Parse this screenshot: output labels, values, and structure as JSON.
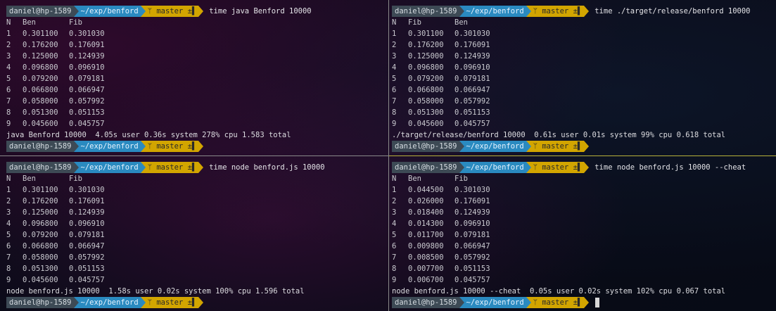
{
  "prompt": {
    "user": "daniel@hp-1589",
    "path": "~/exp/benford",
    "branch_icon": "git-branch-icon",
    "branch": "master ±▌"
  },
  "panes": {
    "tl": {
      "command": "time java Benford 10000",
      "header": [
        "N",
        "Ben",
        "Fib"
      ],
      "rows": [
        [
          "1",
          "0.301100",
          "0.301030"
        ],
        [
          "2",
          "0.176200",
          "0.176091"
        ],
        [
          "3",
          "0.125000",
          "0.124939"
        ],
        [
          "4",
          "0.096800",
          "0.096910"
        ],
        [
          "5",
          "0.079200",
          "0.079181"
        ],
        [
          "6",
          "0.066800",
          "0.066947"
        ],
        [
          "7",
          "0.058000",
          "0.057992"
        ],
        [
          "8",
          "0.051300",
          "0.051153"
        ],
        [
          "9",
          "0.045600",
          "0.045757"
        ]
      ],
      "summary": "java Benford 10000  4.05s user 0.36s system 278% cpu 1.583 total"
    },
    "tr": {
      "command": "time ./target/release/benford 10000",
      "header": [
        "N",
        "Fib",
        "Ben"
      ],
      "rows": [
        [
          "1",
          "0.301100",
          "0.301030"
        ],
        [
          "2",
          "0.176200",
          "0.176091"
        ],
        [
          "3",
          "0.125000",
          "0.124939"
        ],
        [
          "4",
          "0.096800",
          "0.096910"
        ],
        [
          "5",
          "0.079200",
          "0.079181"
        ],
        [
          "6",
          "0.066800",
          "0.066947"
        ],
        [
          "7",
          "0.058000",
          "0.057992"
        ],
        [
          "8",
          "0.051300",
          "0.051153"
        ],
        [
          "9",
          "0.045600",
          "0.045757"
        ]
      ],
      "summary": "./target/release/benford 10000  0.61s user 0.01s system 99% cpu 0.618 total"
    },
    "bl": {
      "command": "time node benford.js 10000",
      "header": [
        "N",
        "Ben",
        "Fib"
      ],
      "rows": [
        [
          "1",
          "0.301100",
          "0.301030"
        ],
        [
          "2",
          "0.176200",
          "0.176091"
        ],
        [
          "3",
          "0.125000",
          "0.124939"
        ],
        [
          "4",
          "0.096800",
          "0.096910"
        ],
        [
          "5",
          "0.079200",
          "0.079181"
        ],
        [
          "6",
          "0.066800",
          "0.066947"
        ],
        [
          "7",
          "0.058000",
          "0.057992"
        ],
        [
          "8",
          "0.051300",
          "0.051153"
        ],
        [
          "9",
          "0.045600",
          "0.045757"
        ]
      ],
      "summary": "node benford.js 10000  1.58s user 0.02s system 100% cpu 1.596 total"
    },
    "br": {
      "command": "time node benford.js 10000 --cheat",
      "header": [
        "N",
        "Ben",
        "Fib"
      ],
      "rows": [
        [
          "1",
          "0.044500",
          "0.301030"
        ],
        [
          "2",
          "0.026000",
          "0.176091"
        ],
        [
          "3",
          "0.018400",
          "0.124939"
        ],
        [
          "4",
          "0.014300",
          "0.096910"
        ],
        [
          "5",
          "0.011700",
          "0.079181"
        ],
        [
          "6",
          "0.009800",
          "0.066947"
        ],
        [
          "7",
          "0.008500",
          "0.057992"
        ],
        [
          "8",
          "0.007700",
          "0.051153"
        ],
        [
          "9",
          "0.006700",
          "0.045757"
        ]
      ],
      "summary": "node benford.js 10000 --cheat  0.05s user 0.02s system 102% cpu 0.067 total"
    }
  },
  "colors": {
    "user_segment": "#3d4a55",
    "path_segment": "#2a8ac0",
    "git_segment": "#d2a500",
    "active_divider": "#b8b23a"
  }
}
